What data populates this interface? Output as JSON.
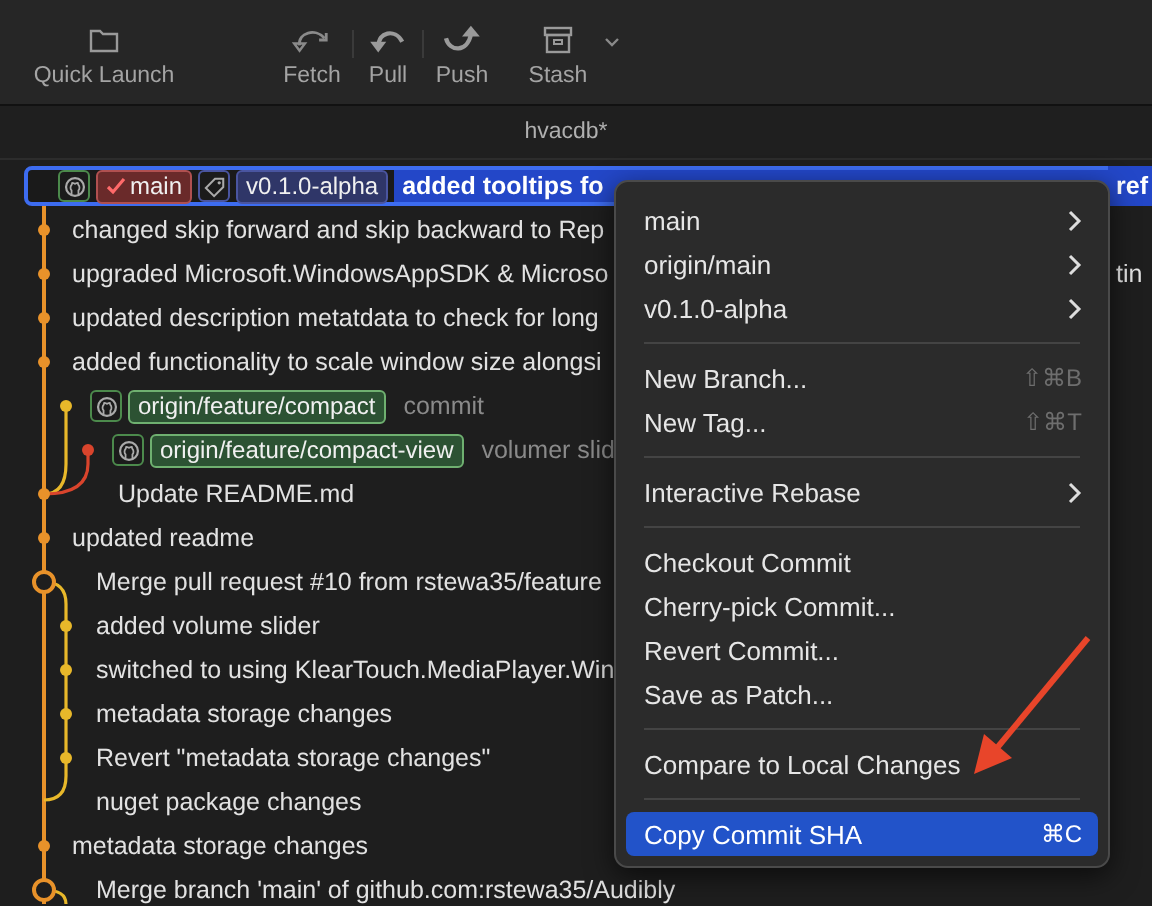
{
  "toolbar": [
    {
      "label": "Quick Launch",
      "kind": "folder"
    },
    {
      "label": "Fetch",
      "kind": "fetch"
    },
    {
      "label": "Pull",
      "kind": "pull"
    },
    {
      "label": "Push",
      "kind": "push"
    },
    {
      "label": "Stash",
      "kind": "stash"
    }
  ],
  "tab": {
    "title": "hvacdb*"
  },
  "commits": [
    {
      "kind": "main",
      "selected": true,
      "badges": [
        {
          "kind": "branch",
          "label": "main",
          "remote": true,
          "current": true
        },
        {
          "kind": "tag",
          "label": "v0.1.0-alpha"
        }
      ],
      "message": "added tooltips fo",
      "tail": "ref"
    },
    {
      "kind": "main",
      "selected": false,
      "message": "changed skip forward and skip backward to Rep"
    },
    {
      "kind": "main",
      "selected": false,
      "message": "upgraded Microsoft.WindowsAppSDK & Microso",
      "tail": "tin"
    },
    {
      "kind": "main",
      "selected": false,
      "message": "updated description metatdata to check for long"
    },
    {
      "kind": "main",
      "selected": false,
      "message": "added functionality to scale window size alongsi"
    },
    {
      "kind": "side",
      "selected": false,
      "badges": [
        {
          "kind": "branch",
          "label": "origin/feature/compact",
          "remote": true,
          "current": false
        }
      ],
      "message": "commit"
    },
    {
      "kind": "nested",
      "selected": false,
      "badges": [
        {
          "kind": "branch",
          "label": "origin/feature/compact-view",
          "remote": true,
          "current": false
        }
      ],
      "message": "volumer slid"
    },
    {
      "kind": "nested",
      "selected": false,
      "message": "Update README.md"
    },
    {
      "kind": "main",
      "selected": false,
      "message": "updated readme"
    },
    {
      "kind": "side",
      "selected": false,
      "message": "Merge pull request #10 from rstewa35/feature"
    },
    {
      "kind": "side",
      "selected": false,
      "message": "added volume slider"
    },
    {
      "kind": "side",
      "selected": false,
      "message": "switched to using KlearTouch.MediaPlayer.Win"
    },
    {
      "kind": "side",
      "selected": false,
      "message": "metadata storage changes"
    },
    {
      "kind": "side",
      "selected": false,
      "message": "Revert \"metadata storage changes\""
    },
    {
      "kind": "side",
      "selected": false,
      "message": "nuget package changes"
    },
    {
      "kind": "main",
      "selected": false,
      "message": "metadata storage changes"
    },
    {
      "kind": "side",
      "selected": false,
      "message": "Merge branch 'main' of github.com:rstewa35/Audibly"
    }
  ],
  "context_menu": [
    {
      "kind": "submenu",
      "label": "main",
      "selected": false
    },
    {
      "kind": "submenu",
      "label": "origin/main",
      "selected": false
    },
    {
      "kind": "submenu",
      "label": "v0.1.0-alpha",
      "selected": false
    },
    {
      "kind": "separator"
    },
    {
      "kind": "item",
      "label": "New Branch...",
      "shortcut": "⇧⌘B",
      "selected": false
    },
    {
      "kind": "item",
      "label": "New Tag...",
      "shortcut": "⇧⌘T",
      "selected": false
    },
    {
      "kind": "separator"
    },
    {
      "kind": "submenu",
      "label": "Interactive Rebase",
      "selected": false
    },
    {
      "kind": "separator"
    },
    {
      "kind": "item",
      "label": "Checkout Commit",
      "selected": false
    },
    {
      "kind": "item",
      "label": "Cherry-pick Commit...",
      "selected": false
    },
    {
      "kind": "item",
      "label": "Revert Commit...",
      "selected": false
    },
    {
      "kind": "item",
      "label": "Save as Patch...",
      "selected": false
    },
    {
      "kind": "separator"
    },
    {
      "kind": "item",
      "label": "Compare to Local Changes",
      "selected": false
    },
    {
      "kind": "separator"
    },
    {
      "kind": "item",
      "label": "Copy Commit SHA",
      "shortcut": "⌘C",
      "selected": true
    }
  ]
}
